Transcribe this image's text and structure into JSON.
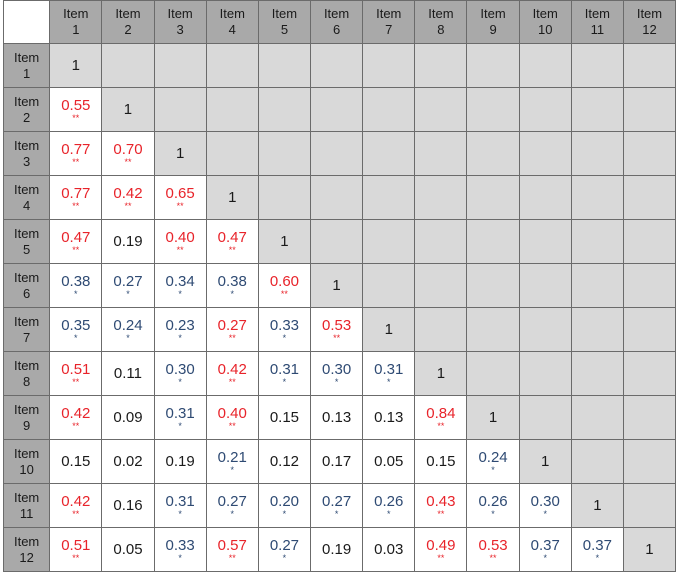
{
  "labels": [
    "Item 1",
    "Item 2",
    "Item 3",
    "Item 4",
    "Item 5",
    "Item 6",
    "Item 7",
    "Item 8",
    "Item 9",
    "Item 10",
    "Item 11",
    "Item 12"
  ],
  "label_word": "Item",
  "label_numbers": [
    "1",
    "2",
    "3",
    "4",
    "5",
    "6",
    "7",
    "8",
    "9",
    "10",
    "11",
    "12"
  ],
  "colors": {
    "strong": "#e8232a",
    "weak": "#2e4a73",
    "none": "#1a1a1a",
    "header_bg": "#a9a9a9",
    "upper_bg": "#d9d9d9"
  },
  "legend_markers": {
    "double": "**",
    "single": "*"
  },
  "matrix": [
    [
      {
        "v": "1",
        "s": ""
      }
    ],
    [
      {
        "v": "0.55",
        "s": "**"
      },
      {
        "v": "1",
        "s": ""
      }
    ],
    [
      {
        "v": "0.77",
        "s": "**"
      },
      {
        "v": "0.70",
        "s": "**"
      },
      {
        "v": "1",
        "s": ""
      }
    ],
    [
      {
        "v": "0.77",
        "s": "**"
      },
      {
        "v": "0.42",
        "s": "**"
      },
      {
        "v": "0.65",
        "s": "**"
      },
      {
        "v": "1",
        "s": ""
      }
    ],
    [
      {
        "v": "0.47",
        "s": "**"
      },
      {
        "v": "0.19",
        "s": ""
      },
      {
        "v": "0.40",
        "s": "**"
      },
      {
        "v": "0.47",
        "s": "**"
      },
      {
        "v": "1",
        "s": ""
      }
    ],
    [
      {
        "v": "0.38",
        "s": "*"
      },
      {
        "v": "0.27",
        "s": "*"
      },
      {
        "v": "0.34",
        "s": "*"
      },
      {
        "v": "0.38",
        "s": "*"
      },
      {
        "v": "0.60",
        "s": "**"
      },
      {
        "v": "1",
        "s": ""
      }
    ],
    [
      {
        "v": "0.35",
        "s": "*"
      },
      {
        "v": "0.24",
        "s": "*"
      },
      {
        "v": "0.23",
        "s": "*"
      },
      {
        "v": "0.27",
        "s": "**"
      },
      {
        "v": "0.33",
        "s": "*"
      },
      {
        "v": "0.53",
        "s": "**"
      },
      {
        "v": "1",
        "s": ""
      }
    ],
    [
      {
        "v": "0.51",
        "s": "**"
      },
      {
        "v": "0.11",
        "s": ""
      },
      {
        "v": "0.30",
        "s": "*"
      },
      {
        "v": "0.42",
        "s": "**"
      },
      {
        "v": "0.31",
        "s": "*"
      },
      {
        "v": "0.30",
        "s": "*"
      },
      {
        "v": "0.31",
        "s": "*"
      },
      {
        "v": "1",
        "s": ""
      }
    ],
    [
      {
        "v": "0.42",
        "s": "**"
      },
      {
        "v": "0.09",
        "s": ""
      },
      {
        "v": "0.31",
        "s": "*"
      },
      {
        "v": "0.40",
        "s": "**"
      },
      {
        "v": "0.15",
        "s": ""
      },
      {
        "v": "0.13",
        "s": ""
      },
      {
        "v": "0.13",
        "s": ""
      },
      {
        "v": "0.84",
        "s": "**"
      },
      {
        "v": "1",
        "s": ""
      }
    ],
    [
      {
        "v": "0.15",
        "s": ""
      },
      {
        "v": "0.02",
        "s": ""
      },
      {
        "v": "0.19",
        "s": ""
      },
      {
        "v": "0.21",
        "s": "*"
      },
      {
        "v": "0.12",
        "s": ""
      },
      {
        "v": "0.17",
        "s": ""
      },
      {
        "v": "0.05",
        "s": ""
      },
      {
        "v": "0.15",
        "s": ""
      },
      {
        "v": "0.24",
        "s": "*"
      },
      {
        "v": "1",
        "s": ""
      }
    ],
    [
      {
        "v": "0.42",
        "s": "**"
      },
      {
        "v": "0.16",
        "s": ""
      },
      {
        "v": "0.31",
        "s": "*"
      },
      {
        "v": "0.27",
        "s": "*"
      },
      {
        "v": "0.20",
        "s": "*"
      },
      {
        "v": "0.27",
        "s": "*"
      },
      {
        "v": "0.26",
        "s": "*"
      },
      {
        "v": "0.43",
        "s": "**"
      },
      {
        "v": "0.26",
        "s": "*"
      },
      {
        "v": "0.30",
        "s": "*"
      },
      {
        "v": "1",
        "s": ""
      }
    ],
    [
      {
        "v": "0.51",
        "s": "**"
      },
      {
        "v": "0.05",
        "s": ""
      },
      {
        "v": "0.33",
        "s": "*"
      },
      {
        "v": "0.57",
        "s": "**"
      },
      {
        "v": "0.27",
        "s": "*"
      },
      {
        "v": "0.19",
        "s": ""
      },
      {
        "v": "0.03",
        "s": ""
      },
      {
        "v": "0.49",
        "s": "**"
      },
      {
        "v": "0.53",
        "s": "**"
      },
      {
        "v": "0.37",
        "s": "*"
      },
      {
        "v": "0.37",
        "s": "*"
      },
      {
        "v": "1",
        "s": ""
      }
    ]
  ]
}
